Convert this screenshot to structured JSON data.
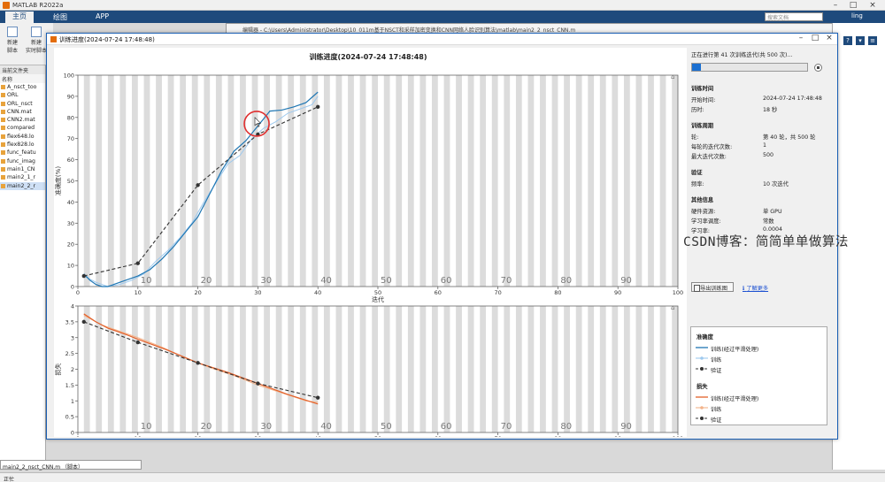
{
  "app": {
    "title": "MATLAB R2022a"
  },
  "ribbon": {
    "tabs": [
      "主页",
      "绘图",
      "APP"
    ],
    "search_placeholder": "搜索文档",
    "user": "ling"
  },
  "toolstrip": {
    "new_script": "新建\n脚本",
    "new_live_script": "新建\n实时脚本"
  },
  "folder_panel": {
    "header": "当前文件夹",
    "name_col": "名称",
    "files": [
      "A_nsct_too",
      "ORL",
      "ORL_nsct",
      "CNN.mat",
      "CNN2.mat",
      "compared",
      "flex648.lo",
      "flex828.lo",
      "func_featu",
      "func_imag",
      "main1_CN",
      "main2_1_r",
      "main2_2_r"
    ]
  },
  "editor": {
    "title": "编辑器 - C:\\Users\\Administrator\\Desktop\\10_011m基于NSCT和采样加密变换和CNN网络人脸识别算法\\matlab\\main2_2_nsct_CNN.m"
  },
  "bottom_tab": "main2_2_nsct_CNN.m （脚本）",
  "status": "正忙",
  "window": {
    "title": "训练进度(2024-07-24 17:48:48)",
    "chart_title": "训练进度(2024-07-24 17:48:48)"
  },
  "info": {
    "progress_text": "正在进行第 41 次训练迭代(共 500 次)...",
    "progress": 0.08,
    "time_header": "训练时间",
    "start_label": "开始时间:",
    "start_value": "2024-07-24 17:48:48",
    "elapsed_label": "历时:",
    "elapsed_value": "18 秒",
    "cycle_header": "训练周期",
    "epoch_label": "轮:",
    "epoch_value": "第 40 轮，共 500 轮",
    "iter_per_epoch_label": "每轮的迭代次数:",
    "iter_per_epoch_value": "1",
    "max_iter_label": "最大迭代次数:",
    "max_iter_value": "500",
    "val_header": "验证",
    "freq_label": "频率:",
    "freq_value": "10 次迭代",
    "other_header": "其他信息",
    "hw_label": "硬件资源:",
    "hw_value": "单 GPU",
    "lr_sched_label": "学习率调度:",
    "lr_sched_value": "常数",
    "lr_label": "学习率:",
    "lr_value": "0.0004",
    "export_button": "导出训练图",
    "learn_more": "了解更多"
  },
  "legend": {
    "acc_header": "准确度",
    "loss_header": "损失",
    "items": [
      "训练(经过平滑处理)",
      "训练",
      "验证"
    ],
    "acc_color": "#1f77b4",
    "acc_raw_color": "#9ec9ee",
    "loss_color": "#e3602a",
    "loss_raw_color": "#f3b38a",
    "val_color": "#333333"
  },
  "watermark": "CSDN博客：简简单单做算法",
  "chart_data": [
    {
      "type": "line",
      "title": "训练进度(2024-07-24 17:48:48)",
      "xlabel": "迭代",
      "ylabel": "准确度(%)",
      "xlim": [
        0,
        100
      ],
      "ylim": [
        0,
        100
      ],
      "xticks": [
        0,
        10,
        20,
        30,
        40,
        50,
        60,
        70,
        80,
        90,
        100
      ],
      "yticks": [
        0,
        10,
        20,
        30,
        40,
        50,
        60,
        70,
        80,
        90,
        100
      ],
      "epoch_labels": [
        10,
        20,
        30,
        40,
        50,
        60,
        70,
        80,
        90
      ],
      "series": [
        {
          "name": "训练(经过平滑处理)",
          "x": [
            1,
            2,
            3,
            4,
            5,
            6,
            7,
            8,
            9,
            10,
            12,
            14,
            16,
            18,
            20,
            22,
            24,
            26,
            28,
            30,
            32,
            34,
            36,
            38,
            40
          ],
          "y": [
            6,
            3,
            1,
            0,
            0,
            1,
            2,
            3,
            4,
            5,
            8,
            13,
            19,
            26,
            33,
            44,
            55,
            64,
            69,
            76,
            83,
            83.5,
            85,
            87,
            92
          ]
        },
        {
          "name": "训练",
          "x": [
            1,
            3,
            5,
            7,
            9,
            11,
            13,
            15,
            17,
            19,
            21,
            23,
            25,
            27,
            29,
            31,
            33,
            35,
            37,
            39,
            40
          ],
          "y": [
            5,
            2,
            0,
            1,
            3,
            6,
            12,
            17,
            23,
            30,
            40,
            49,
            58,
            62,
            70,
            75,
            78,
            82,
            84,
            86,
            90
          ]
        },
        {
          "name": "验证",
          "x": [
            1,
            10,
            20,
            30,
            40
          ],
          "y": [
            5,
            11,
            48,
            72,
            85
          ]
        }
      ]
    },
    {
      "type": "line",
      "xlabel": "迭代",
      "ylabel": "损失",
      "xlim": [
        0,
        100
      ],
      "ylim": [
        0,
        4
      ],
      "yticks": [
        0,
        0.5,
        1,
        1.5,
        2,
        2.5,
        3,
        3.5,
        4
      ],
      "epoch_labels": [
        10,
        20,
        30,
        40,
        50,
        60,
        70,
        80,
        90
      ],
      "series": [
        {
          "name": "训练(经过平滑处理)",
          "x": [
            1,
            3,
            5,
            8,
            10,
            15,
            20,
            25,
            30,
            35,
            40
          ],
          "y": [
            3.75,
            3.5,
            3.3,
            3.1,
            2.95,
            2.6,
            2.2,
            1.9,
            1.55,
            1.2,
            0.9
          ]
        },
        {
          "name": "训练",
          "x": [
            1,
            4,
            7,
            10,
            14,
            18,
            22,
            26,
            30,
            34,
            38,
            40
          ],
          "y": [
            3.7,
            3.4,
            3.2,
            3.0,
            2.7,
            2.35,
            2.05,
            1.8,
            1.5,
            1.25,
            1.0,
            0.95
          ]
        },
        {
          "name": "验证",
          "x": [
            1,
            10,
            20,
            30,
            40
          ],
          "y": [
            3.5,
            2.85,
            2.2,
            1.55,
            1.1
          ]
        }
      ]
    }
  ]
}
